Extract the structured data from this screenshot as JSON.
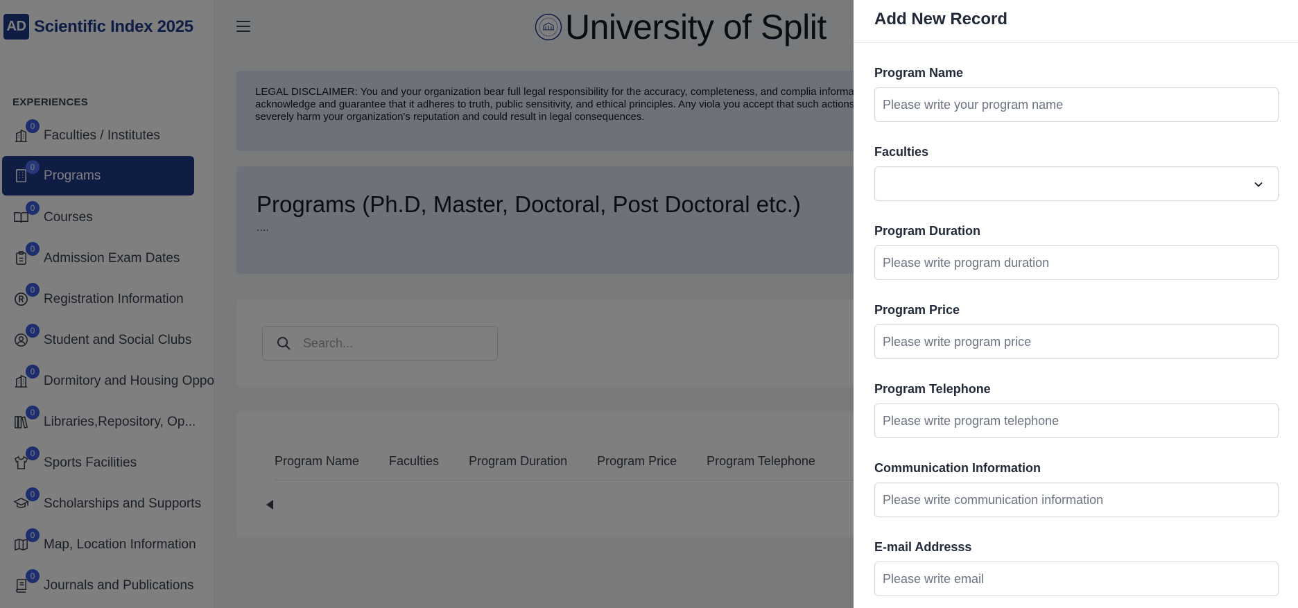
{
  "brand": {
    "logo": "AD",
    "name": "Scientific Index 2025"
  },
  "sidebar": {
    "section_title": "EXPERIENCES",
    "items": [
      {
        "label": "Faculties / Institutes",
        "badge": "0",
        "icon": "building-icon",
        "active": false
      },
      {
        "label": "Programs",
        "badge": "0",
        "icon": "office-icon",
        "active": true
      },
      {
        "label": "Courses",
        "badge": "0",
        "icon": "book-open-icon",
        "active": false
      },
      {
        "label": "Admission Exam Dates",
        "badge": "0",
        "icon": "clipboard-icon",
        "active": false
      },
      {
        "label": "Registration Information",
        "badge": "0",
        "icon": "registered-icon",
        "active": false
      },
      {
        "label": "Student and Social Clubs",
        "badge": "0",
        "icon": "user-circle-icon",
        "active": false
      },
      {
        "label": "Dormitory and Housing Oppor",
        "badge": "0",
        "icon": "building-icon",
        "active": false
      },
      {
        "label": "Libraries,Repository, Op...",
        "badge": "0",
        "icon": "library-icon",
        "active": false
      },
      {
        "label": "Sports Facilities",
        "badge": "0",
        "icon": "shirt-icon",
        "active": false
      },
      {
        "label": "Scholarships and Supports",
        "badge": "0",
        "icon": "graduation-cap-icon",
        "active": false
      },
      {
        "label": "Map, Location Information",
        "badge": "0",
        "icon": "map-icon",
        "active": false
      },
      {
        "label": "Journals and Publications",
        "badge": "0",
        "icon": "journal-icon",
        "active": false
      }
    ]
  },
  "header": {
    "university": "University of Split"
  },
  "disclaimer": {
    "text": "LEGAL DISCLAIMER: You and your organization bear full legal responsibility for the accuracy, completeness, and complia information, you acknowledge and guarantee that it adheres to truth, public sensitivity, and ethical principles. Any viola you accept that such actions may severely harm your organization's reputation and could result in legal consequences."
  },
  "page": {
    "title": "Programs (Ph.D, Master, Doctoral, Post Doctoral etc.)",
    "subtitle": "...."
  },
  "search": {
    "placeholder": "Search..."
  },
  "table": {
    "columns": [
      "Program Name",
      "Faculties",
      "Program Duration",
      "Program Price",
      "Program Telephone"
    ]
  },
  "drawer": {
    "title": "Add New Record",
    "fields": {
      "program_name": {
        "label": "Program Name",
        "placeholder": "Please write your program name"
      },
      "faculties": {
        "label": "Faculties",
        "value": ""
      },
      "program_duration": {
        "label": "Program Duration",
        "placeholder": "Please write program duration"
      },
      "program_price": {
        "label": "Program Price",
        "placeholder": "Please write program price"
      },
      "program_telephone": {
        "label": "Program Telephone",
        "placeholder": "Please write program telephone"
      },
      "communication": {
        "label": "Communication Information",
        "placeholder": "Please write communication information"
      },
      "email": {
        "label": "E-mail Addresss",
        "placeholder": "Please write email"
      }
    }
  },
  "colors": {
    "brand": "#1e3a8a",
    "badge": "#3b5bdb",
    "panel": "#dbe4f5",
    "overlay": "rgba(0,0,0,0.5)"
  }
}
